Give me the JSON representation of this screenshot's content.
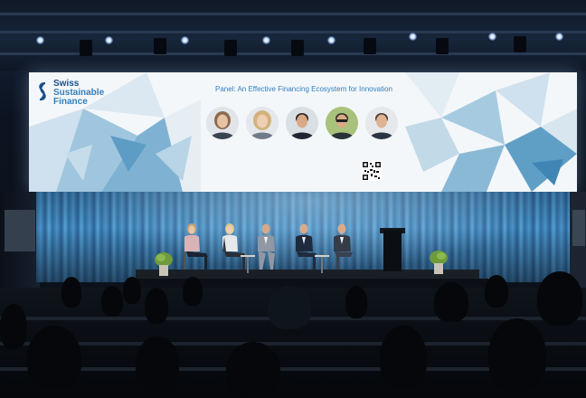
{
  "screen": {
    "logo_line1": "Swiss",
    "logo_line2": "Sustainable",
    "logo_line3": "Finance",
    "panel_title": "Panel: An Effective Financing Ecosystem for Innovation",
    "brand_color": "#2f7fc1"
  },
  "speakers": [
    {
      "name": "",
      "role": ""
    },
    {
      "name": "",
      "role": ""
    },
    {
      "name": "",
      "role": ""
    },
    {
      "name": "",
      "role": ""
    },
    {
      "name": "",
      "role": ""
    }
  ]
}
